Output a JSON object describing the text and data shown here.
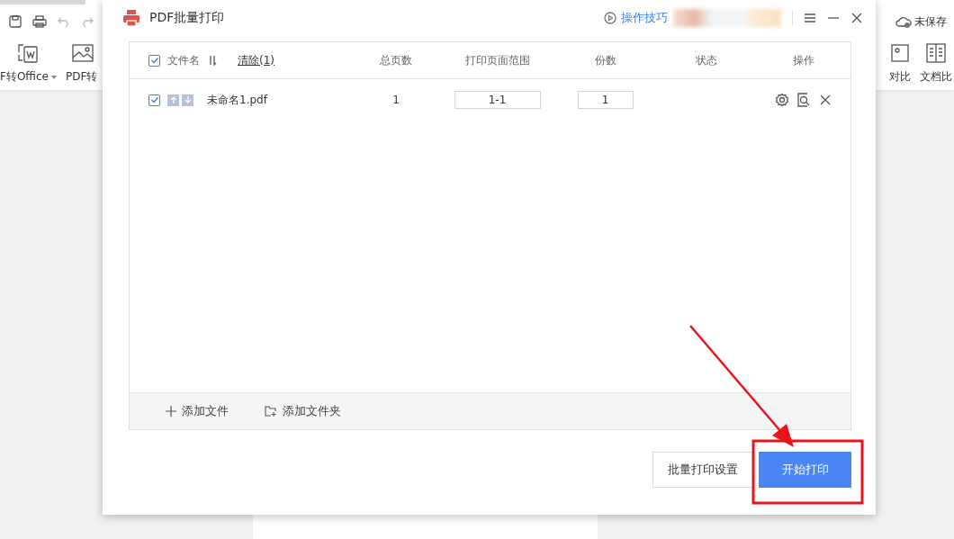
{
  "app": {
    "toolbar_left": [
      {
        "label": "F转Office",
        "dropdown": true
      },
      {
        "label": "PDF转",
        "dropdown": false
      }
    ],
    "save_status": "未保存",
    "toolbar_right": [
      {
        "label": "对比"
      },
      {
        "label": "文档比"
      }
    ]
  },
  "dialog": {
    "title": "PDF批量打印",
    "tips_link": "操作技巧",
    "table": {
      "select_all_checked": true,
      "columns": [
        "文件名",
        "总页数",
        "打印页面范围",
        "份数",
        "状态",
        "操作"
      ],
      "clear_link": "清除(1)",
      "rows": [
        {
          "checked": true,
          "name": "未命名1.pdf",
          "pages": "1",
          "range": "1-1",
          "copies": "1"
        }
      ]
    },
    "footer_actions": [
      "添加文件",
      "添加文件夹"
    ],
    "buttons": [
      {
        "label": "批量打印设置",
        "primary": false
      },
      {
        "label": "开始打印",
        "primary": true
      }
    ]
  },
  "annotation": {
    "color": "#e8141b"
  }
}
